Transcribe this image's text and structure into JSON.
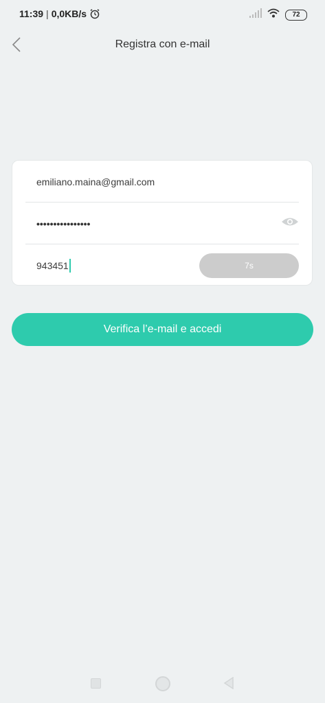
{
  "status_bar": {
    "time": "11:39",
    "separator": "|",
    "network_speed": "0,0KB/s",
    "battery": "72"
  },
  "header": {
    "title": "Registra con e-mail"
  },
  "form": {
    "email_value": "emiliano.maina@gmail.com",
    "password_value": "••••••••••••••••",
    "code_value": "943451",
    "resend_countdown": "7s"
  },
  "primary_button": {
    "label": "Verifica l’e-mail e accedi"
  },
  "colors": {
    "accent": "#2ecbad",
    "background": "#eef1f2",
    "disabled_button": "#cccccc"
  },
  "icons": {
    "back": "chevron-left-icon",
    "alarm": "alarm-clock-icon",
    "signal": "signal-icon",
    "wifi": "wifi-icon",
    "battery": "battery-icon",
    "eye": "eye-icon",
    "nav_recents": "square-icon",
    "nav_home": "circle-icon",
    "nav_back": "triangle-back-icon"
  }
}
